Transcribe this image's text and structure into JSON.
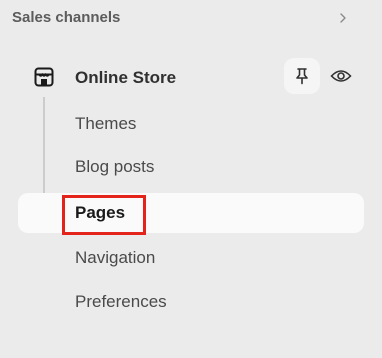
{
  "sales_channels": {
    "title": "Sales channels",
    "chevron_icon": "chevron-right-icon"
  },
  "online_store": {
    "label": "Online Store",
    "icon": "store-icon",
    "actions": [
      "pin-icon",
      "eye-icon"
    ],
    "sub_items": [
      {
        "label": "Themes",
        "active": false
      },
      {
        "label": "Blog posts",
        "active": false
      },
      {
        "label": "Pages",
        "active": true
      },
      {
        "label": "Navigation",
        "active": false
      },
      {
        "label": "Preferences",
        "active": false
      }
    ]
  },
  "colors": {
    "background": "#ebebeb",
    "active_background": "#fafafa",
    "highlight": "#e4241b"
  }
}
